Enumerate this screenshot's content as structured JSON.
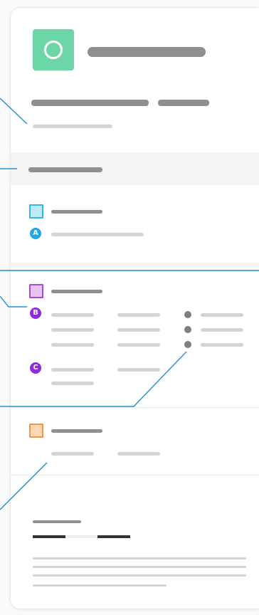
{
  "header": {
    "logo_icon": "circle-ring-icon",
    "logo_color": "#6dd6a6"
  },
  "sections": [
    {
      "id": "a",
      "square_color": "#bdeaf7",
      "square_border": "#39b6e6",
      "badge_letter": "A",
      "badge_color": "#22a7e6"
    },
    {
      "id": "b",
      "square_color": "#e6c4f5",
      "square_border": "#a94ad6",
      "badge_letter": "B",
      "badge_color": "#8e2ae0"
    },
    {
      "id": "c",
      "badge_letter": "C",
      "badge_color": "#8e2ae0"
    },
    {
      "id": "d",
      "square_color": "#fcd7b5",
      "square_border": "#ee9a45"
    }
  ],
  "colors": {
    "connector": "#1f8fd6",
    "placeholder_dark": "#8f8f8f",
    "placeholder_light": "#d4d4d4"
  }
}
